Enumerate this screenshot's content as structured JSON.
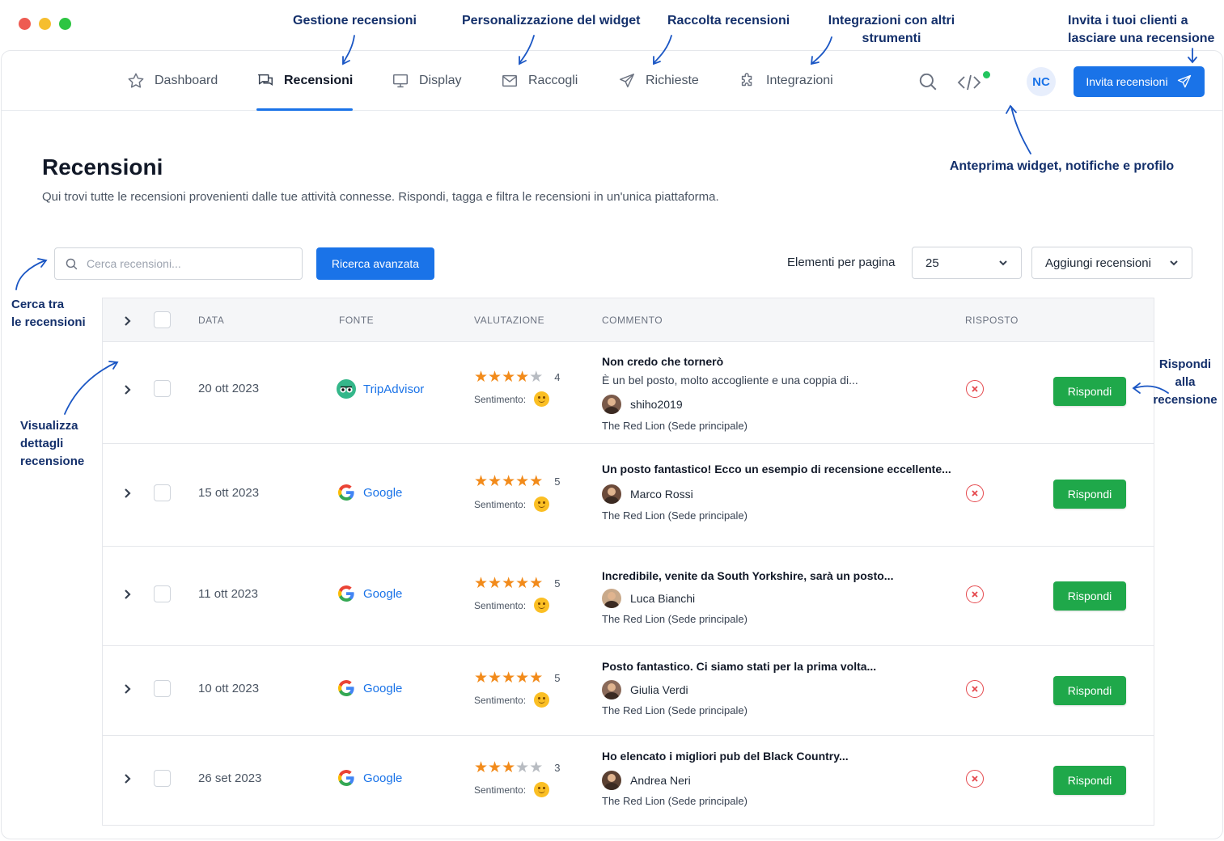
{
  "annotations": {
    "gestione": "Gestione recensioni",
    "personalizzazione": "Personalizzazione del widget",
    "raccolta": "Raccolta recensioni",
    "integrazioni_line1": "Integrazioni con altri",
    "integrazioni_line2": "strumenti",
    "invita_line1": "Invita i tuoi clienti a",
    "invita_line2": "lasciare una recensione",
    "anteprima": "Anteprima widget, notifiche e profilo",
    "cerca_line1": "Cerca tra",
    "cerca_line2": "le recensioni",
    "visualizza_line1": "Visualizza",
    "visualizza_line2": "dettagli",
    "visualizza_line3": "recensione",
    "rispondi_line1": "Rispondi",
    "rispondi_line2": "alla",
    "rispondi_line3": "recensione",
    "color": "#14306b"
  },
  "nav": {
    "items": [
      {
        "label": "Dashboard",
        "icon": "star-icon"
      },
      {
        "label": "Recensioni",
        "icon": "chat-icon",
        "active": true
      },
      {
        "label": "Display",
        "icon": "monitor-icon"
      },
      {
        "label": "Raccogli",
        "icon": "mail-icon"
      },
      {
        "label": "Richieste",
        "icon": "send-icon"
      },
      {
        "label": "Integrazioni",
        "icon": "puzzle-icon"
      }
    ],
    "avatar_initials": "NC",
    "invite_button": "Invita recensioni"
  },
  "page": {
    "title": "Recensioni",
    "subtitle": "Qui trovi tutte le recensioni provenienti dalle tue attività connesse. Rispondi, tagga e filtra le recensioni in un'unica piattaforma."
  },
  "toolbar": {
    "search_placeholder": "Cerca recensioni...",
    "advanced_search": "Ricerca avanzata",
    "per_page_label": "Elementi per pagina",
    "per_page_value": "25",
    "add_reviews": "Aggiungi recensioni"
  },
  "table": {
    "headers": {
      "date": "DATA",
      "source": "FONTE",
      "rating": "VALUTAZIONE",
      "comment": "COMMENTO",
      "replied": "RISPOSTO"
    },
    "sentiment_label": "Sentimento:",
    "reply_button": "Rispondi",
    "rows": [
      {
        "date": "20 ott 2023",
        "source": "TripAdvisor",
        "rating": 4,
        "rating_label": "4",
        "title": "Non credo che tornerò",
        "text": "È un bel posto, molto accogliente e una coppia di...",
        "user": "shiho2019",
        "location": "The Red Lion (Sede principale)",
        "replied": false
      },
      {
        "date": "15 ott 2023",
        "source": "Google",
        "rating": 5,
        "rating_label": "5",
        "title": "Un posto fantastico! Ecco un esempio di recensione eccellente...",
        "text": "",
        "user": "Marco Rossi",
        "location": "The Red Lion (Sede principale)",
        "replied": false
      },
      {
        "date": "11 ott 2023",
        "source": "Google",
        "rating": 5,
        "rating_label": "5",
        "title": "Incredibile, venite da South Yorkshire, sarà un posto...",
        "text": "",
        "user": "Luca Bianchi",
        "location": "The Red Lion (Sede principale)",
        "replied": false
      },
      {
        "date": "10 ott 2023",
        "source": "Google",
        "rating": 5,
        "rating_label": "5",
        "title": "Posto fantastico. Ci siamo stati per la prima volta...",
        "text": "",
        "user": "Giulia Verdi",
        "location": "The Red Lion (Sede principale)",
        "replied": false
      },
      {
        "date": "26 set 2023",
        "source": "Google",
        "rating": 3,
        "rating_label": "3",
        "title": "Ho elencato i migliori pub del Black Country...",
        "text": "",
        "user": "Andrea Neri",
        "location": "The Red Lion (Sede principale)",
        "replied": false
      }
    ]
  },
  "colors": {
    "primary": "#1a73e8",
    "success": "#1fa84a",
    "danger": "#e5484d",
    "star": "#f28b1b"
  }
}
